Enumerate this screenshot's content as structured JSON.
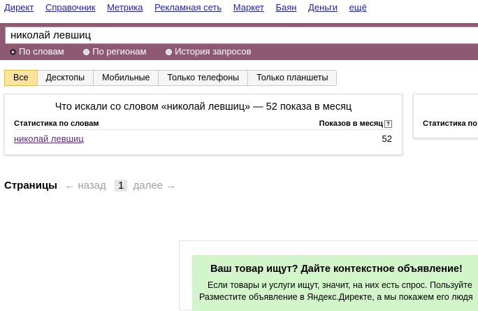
{
  "topnav": {
    "items": [
      "Директ",
      "Справочник",
      "Метрика",
      "Рекламная сеть",
      "Маркет",
      "Баян",
      "Деньги",
      "ещё"
    ]
  },
  "search": {
    "value": "николай левшиц",
    "radios": [
      {
        "label": "По словам",
        "selected": true
      },
      {
        "label": "По регионам",
        "selected": false
      },
      {
        "label": "История запросов",
        "selected": false
      }
    ]
  },
  "tabs": [
    "Все",
    "Десктопы",
    "Мобильные",
    "Только телефоны",
    "Только планшеты"
  ],
  "active_tab": "Все",
  "stats": {
    "title": "Что искали со словом «николай левшиц» — 52 показа в месяц",
    "col_left": "Статистика по словам",
    "col_right": "Показов в месяц",
    "help_glyph": "?",
    "rows": [
      {
        "word": "николай левшиц",
        "count": "52"
      }
    ]
  },
  "stats2": {
    "col_left": "Статистика по"
  },
  "pager": {
    "label": "Страницы",
    "prev": "← назад",
    "current": "1",
    "next": "далее →"
  },
  "promo": {
    "title": "Ваш товар ищут? Дайте контекстное объявление!",
    "line1": "Если товары и услуги ищут, значит, на них есть спрос. Пользуйте",
    "line2": "Разместите объявление в Яндекс.Директе, а мы покажем его людя"
  },
  "colors": {
    "accent_bar": "#8e5a73",
    "active_tab": "#fde49a",
    "promo_bg": "#d2f5c9",
    "link": "#1f1fb6"
  }
}
